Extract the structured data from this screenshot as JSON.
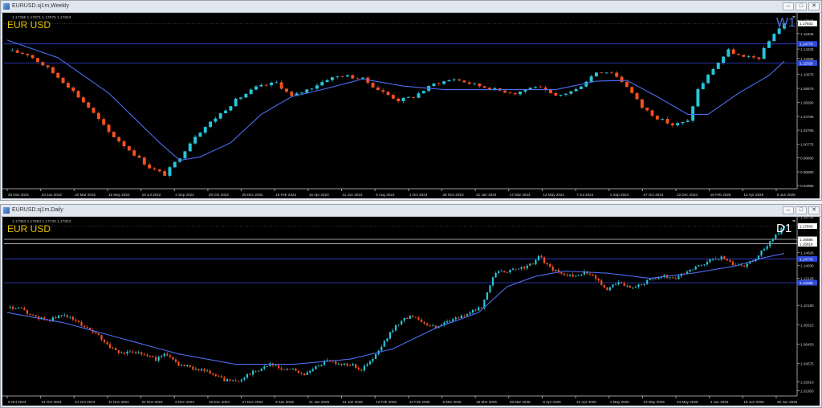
{
  "charts": [
    {
      "window_title": "EURUSD.sj1m,Weekly",
      "ohlc_text": "1.17285 1.17871 1.17076 1.17843",
      "symbol_label": "EUR USD",
      "timeframe_label": "W1",
      "window_buttons": [
        "–",
        "□",
        "✕"
      ],
      "chart_data": {
        "type": "candlestick",
        "ylim": [
          0.945,
          1.19
        ],
        "price_ticks": [
          "1.17843",
          "1.16405",
          "1.14225",
          "1.12895",
          "1.10675",
          "1.08675",
          "1.06690",
          "1.04705",
          "1.02765",
          "1.00775",
          "0.98860",
          "0.96880",
          "0.94955"
        ],
        "price_tick_values": [
          1.1825,
          1.16405,
          1.14225,
          1.12895,
          1.10675,
          1.08675,
          1.0669,
          1.04705,
          1.02765,
          1.00775,
          0.9886,
          0.9688,
          0.94955
        ],
        "date_ticks": [
          "28 Nov 2021",
          "23 Jan 2022",
          "20 Mar 2022",
          "15 May 2022",
          "10 Jul 2022",
          "4 Sep 2022",
          "30 Oct 2022",
          "25 Dec 2022",
          "19 Feb 2023",
          "16 Apr 2023",
          "11 Jun 2023",
          "6 Aug 2023",
          "1 Oct 2023",
          "26 Nov 2023",
          "21 Jan 2024",
          "17 Mar 2024",
          "12 May 2024",
          "7 Jul 2024",
          "1 Sep 2024",
          "27 Oct 2024",
          "22 Dec 2024",
          "16 Feb 2025",
          "13 Apr 2025",
          "8 Jun 2025"
        ],
        "hlines": [
          {
            "value": 1.1495,
            "label": "1.14770",
            "color": "#3344dd"
          },
          {
            "value": 1.1225,
            "label": "1.12329",
            "color": "#3344dd"
          }
        ],
        "current_price": {
          "value": 1.17843,
          "label": "1.17843"
        },
        "path": [
          [
            0,
            1.14
          ],
          [
            4,
            1.135
          ],
          [
            8,
            1.115
          ],
          [
            12,
            1.09
          ],
          [
            16,
            1.06
          ],
          [
            20,
            1.025
          ],
          [
            24,
            1.0
          ],
          [
            28,
            0.975
          ],
          [
            31,
            0.965
          ],
          [
            34,
            0.99
          ],
          [
            37,
            1.02
          ],
          [
            41,
            1.045
          ],
          [
            45,
            1.07
          ],
          [
            49,
            1.088
          ],
          [
            53,
            1.095
          ],
          [
            56,
            1.075
          ],
          [
            60,
            1.088
          ],
          [
            63,
            1.1
          ],
          [
            66,
            1.105
          ],
          [
            70,
            1.1
          ],
          [
            73,
            1.085
          ],
          [
            77,
            1.07
          ],
          [
            80,
            1.075
          ],
          [
            84,
            1.093
          ],
          [
            88,
            1.1
          ],
          [
            92,
            1.092
          ],
          [
            96,
            1.085
          ],
          [
            100,
            1.08
          ],
          [
            104,
            1.09
          ],
          [
            108,
            1.075
          ],
          [
            112,
            1.085
          ],
          [
            116,
            1.11
          ],
          [
            119,
            1.11
          ],
          [
            122,
            1.09
          ],
          [
            125,
            1.06
          ],
          [
            128,
            1.045
          ],
          [
            131,
            1.035
          ],
          [
            134,
            1.04
          ],
          [
            136,
            1.085
          ],
          [
            139,
            1.115
          ],
          [
            142,
            1.14
          ],
          [
            145,
            1.13
          ],
          [
            148,
            1.13
          ],
          [
            151,
            1.165
          ],
          [
            153,
            1.178
          ]
        ],
        "ma": [
          [
            0,
            1.155
          ],
          [
            10,
            1.13
          ],
          [
            20,
            1.08
          ],
          [
            30,
            1.01
          ],
          [
            34,
            0.985
          ],
          [
            38,
            0.99
          ],
          [
            44,
            1.01
          ],
          [
            50,
            1.05
          ],
          [
            56,
            1.075
          ],
          [
            62,
            1.085
          ],
          [
            70,
            1.1
          ],
          [
            78,
            1.09
          ],
          [
            86,
            1.085
          ],
          [
            92,
            1.085
          ],
          [
            100,
            1.085
          ],
          [
            108,
            1.085
          ],
          [
            116,
            1.097
          ],
          [
            122,
            1.098
          ],
          [
            128,
            1.075
          ],
          [
            134,
            1.05
          ],
          [
            138,
            1.05
          ],
          [
            144,
            1.08
          ],
          [
            150,
            1.105
          ],
          [
            153,
            1.125
          ]
        ]
      }
    },
    {
      "window_title": "EURUSD.sj1m,Daily",
      "ohlc_text": "1.17853 1.17853 1.17730 1.17843",
      "symbol_label": "EUR USD",
      "timeframe_label": "D1",
      "window_buttons": [
        "–",
        "□",
        "✕"
      ],
      "chart_data": {
        "type": "candlestick",
        "ylim": [
          1.0145,
          1.185
        ],
        "price_ticks": [
          "1.18745",
          "1.17843",
          "1.16566",
          "1.15614",
          "1.14826",
          "1.14770",
          "1.14030",
          "1.12125",
          "1.12329",
          "1.10190",
          "1.08315",
          "1.06450",
          "1.04575",
          "1.02810",
          "1.01950"
        ],
        "price_tick_values": [
          1.18745,
          1.1795,
          1.1649,
          1.1613,
          1.153,
          1.1468,
          1.1405,
          1.128,
          1.1238,
          1.1019,
          1.08315,
          1.0645,
          1.04575,
          1.0281,
          1.0195
        ],
        "date_ticks": [
          "9 Oct 2024",
          "31 Oct 2024",
          "21 Oct 2024",
          "11 Nov 2024",
          "22 Nov 2024",
          "6 Dec 2024",
          "16 Dec 2024",
          "27 Dec 2024",
          "9 Jan 2025",
          "21 Jan 2025",
          "31 Jan 2025",
          "12 Feb 2025",
          "24 Feb 2025",
          "6 Mar 2025",
          "18 Mar 2025",
          "28 Mar 2025",
          "9 Apr 2025",
          "21 Apr 2025",
          "1 May 2025",
          "13 May 2025",
          "23 May 2025",
          "4 Jun 2025",
          "16 Jun 2025",
          "26 Jun 2025"
        ],
        "hlines": [
          {
            "value": 1.1656,
            "label": "1.16566",
            "color": "#cccccc"
          },
          {
            "value": 1.1614,
            "label": "1.15614",
            "color": "#cccccc"
          },
          {
            "value": 1.1468,
            "label": "1.14770",
            "color": "#3344dd"
          },
          {
            "value": 1.1238,
            "label": "1.12329",
            "color": "#3344dd"
          }
        ],
        "current_price": {
          "value": 1.17843,
          "label": "1.17843"
        },
        "path": [
          [
            0,
            1.1
          ],
          [
            5,
            1.098
          ],
          [
            10,
            1.09
          ],
          [
            15,
            1.088
          ],
          [
            20,
            1.093
          ],
          [
            25,
            1.085
          ],
          [
            28,
            1.08
          ],
          [
            32,
            1.072
          ],
          [
            36,
            1.062
          ],
          [
            40,
            1.055
          ],
          [
            44,
            1.058
          ],
          [
            48,
            1.055
          ],
          [
            52,
            1.05
          ],
          [
            56,
            1.055
          ],
          [
            60,
            1.045
          ],
          [
            64,
            1.042
          ],
          [
            68,
            1.04
          ],
          [
            72,
            1.035
          ],
          [
            76,
            1.03
          ],
          [
            80,
            1.028
          ],
          [
            84,
            1.035
          ],
          [
            88,
            1.04
          ],
          [
            92,
            1.045
          ],
          [
            96,
            1.04
          ],
          [
            100,
            1.04
          ],
          [
            104,
            1.035
          ],
          [
            108,
            1.042
          ],
          [
            112,
            1.05
          ],
          [
            116,
            1.045
          ],
          [
            120,
            1.045
          ],
          [
            124,
            1.04
          ],
          [
            128,
            1.05
          ],
          [
            131,
            1.062
          ],
          [
            134,
            1.075
          ],
          [
            138,
            1.088
          ],
          [
            142,
            1.092
          ],
          [
            146,
            1.085
          ],
          [
            150,
            1.08
          ],
          [
            154,
            1.087
          ],
          [
            158,
            1.09
          ],
          [
            162,
            1.095
          ],
          [
            166,
            1.1
          ],
          [
            170,
            1.13
          ],
          [
            173,
            1.135
          ],
          [
            176,
            1.135
          ],
          [
            180,
            1.138
          ],
          [
            184,
            1.142
          ],
          [
            186,
            1.15
          ],
          [
            190,
            1.138
          ],
          [
            194,
            1.132
          ],
          [
            198,
            1.13
          ],
          [
            202,
            1.134
          ],
          [
            206,
            1.128
          ],
          [
            210,
            1.118
          ],
          [
            214,
            1.125
          ],
          [
            218,
            1.118
          ],
          [
            222,
            1.122
          ],
          [
            226,
            1.128
          ],
          [
            230,
            1.13
          ],
          [
            234,
            1.128
          ],
          [
            238,
            1.135
          ],
          [
            242,
            1.14
          ],
          [
            246,
            1.145
          ],
          [
            250,
            1.148
          ],
          [
            254,
            1.142
          ],
          [
            258,
            1.14
          ],
          [
            262,
            1.148
          ],
          [
            266,
            1.16
          ],
          [
            270,
            1.172
          ],
          [
            272,
            1.178
          ]
        ],
        "ma": [
          [
            0,
            1.095
          ],
          [
            20,
            1.085
          ],
          [
            40,
            1.07
          ],
          [
            60,
            1.055
          ],
          [
            80,
            1.045
          ],
          [
            100,
            1.045
          ],
          [
            120,
            1.05
          ],
          [
            135,
            1.06
          ],
          [
            150,
            1.08
          ],
          [
            165,
            1.095
          ],
          [
            175,
            1.12
          ],
          [
            185,
            1.13
          ],
          [
            195,
            1.135
          ],
          [
            210,
            1.133
          ],
          [
            225,
            1.128
          ],
          [
            240,
            1.133
          ],
          [
            255,
            1.14
          ],
          [
            265,
            1.148
          ],
          [
            272,
            1.152
          ]
        ]
      }
    }
  ]
}
